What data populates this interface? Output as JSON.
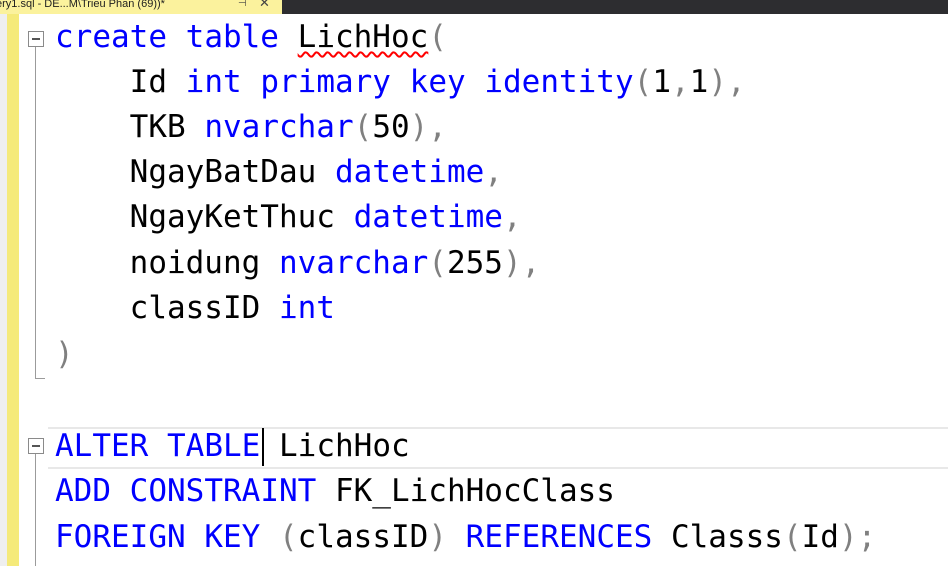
{
  "tab": {
    "title": "ery1.sql - DE...M\\Trieu Phan (69))*",
    "pin_icon": "pin-icon",
    "close_icon": "close-icon"
  },
  "colors": {
    "keyword": "#0000ff",
    "punctuation": "#808080",
    "identifier": "#000000",
    "tab_background": "#fbf29d",
    "change_bar": "#f5ea7a",
    "error_squiggle": "#ff0000"
  },
  "code": {
    "line1": {
      "k1": "create",
      "k2": "table",
      "name": "LichHoc",
      "p1": "("
    },
    "line2": {
      "col": "Id",
      "k1": "int",
      "k2": "primary",
      "k3": "key",
      "k4": "identity",
      "p1": "(",
      "n1": "1",
      "p2": ",",
      "n2": "1",
      "p3": "),",
      "indent": "    "
    },
    "line3": {
      "col": "TKB",
      "k1": "nvarchar",
      "p1": "(",
      "n1": "50",
      "p2": "),",
      "indent": "    "
    },
    "line4": {
      "col": "NgayBatDau",
      "k1": "datetime",
      "p1": ",",
      "indent": "    "
    },
    "line5": {
      "col": "NgayKetThuc",
      "k1": "datetime",
      "p1": ",",
      "indent": "    "
    },
    "line6": {
      "col": "noidung",
      "k1": "nvarchar",
      "p1": "(",
      "n1": "255",
      "p2": "),",
      "indent": "    "
    },
    "line7": {
      "col": "classID",
      "k1": "int",
      "indent": "    "
    },
    "line8": {
      "p1": ")"
    },
    "line10": {
      "k1": "ALTER",
      "k2": "TABLE",
      "name": "LichHoc"
    },
    "line11": {
      "k1": "ADD",
      "k2": "CONSTRAINT",
      "name": "FK_LichHocClass"
    },
    "line12": {
      "k1": "FOREIGN",
      "k2": "KEY",
      "p1": "(",
      "col": "classID",
      "p2": ")",
      "k3": "REFERENCES",
      "ref": "Classs",
      "p3": "(",
      "refcol": "Id",
      "p4": ");"
    }
  }
}
